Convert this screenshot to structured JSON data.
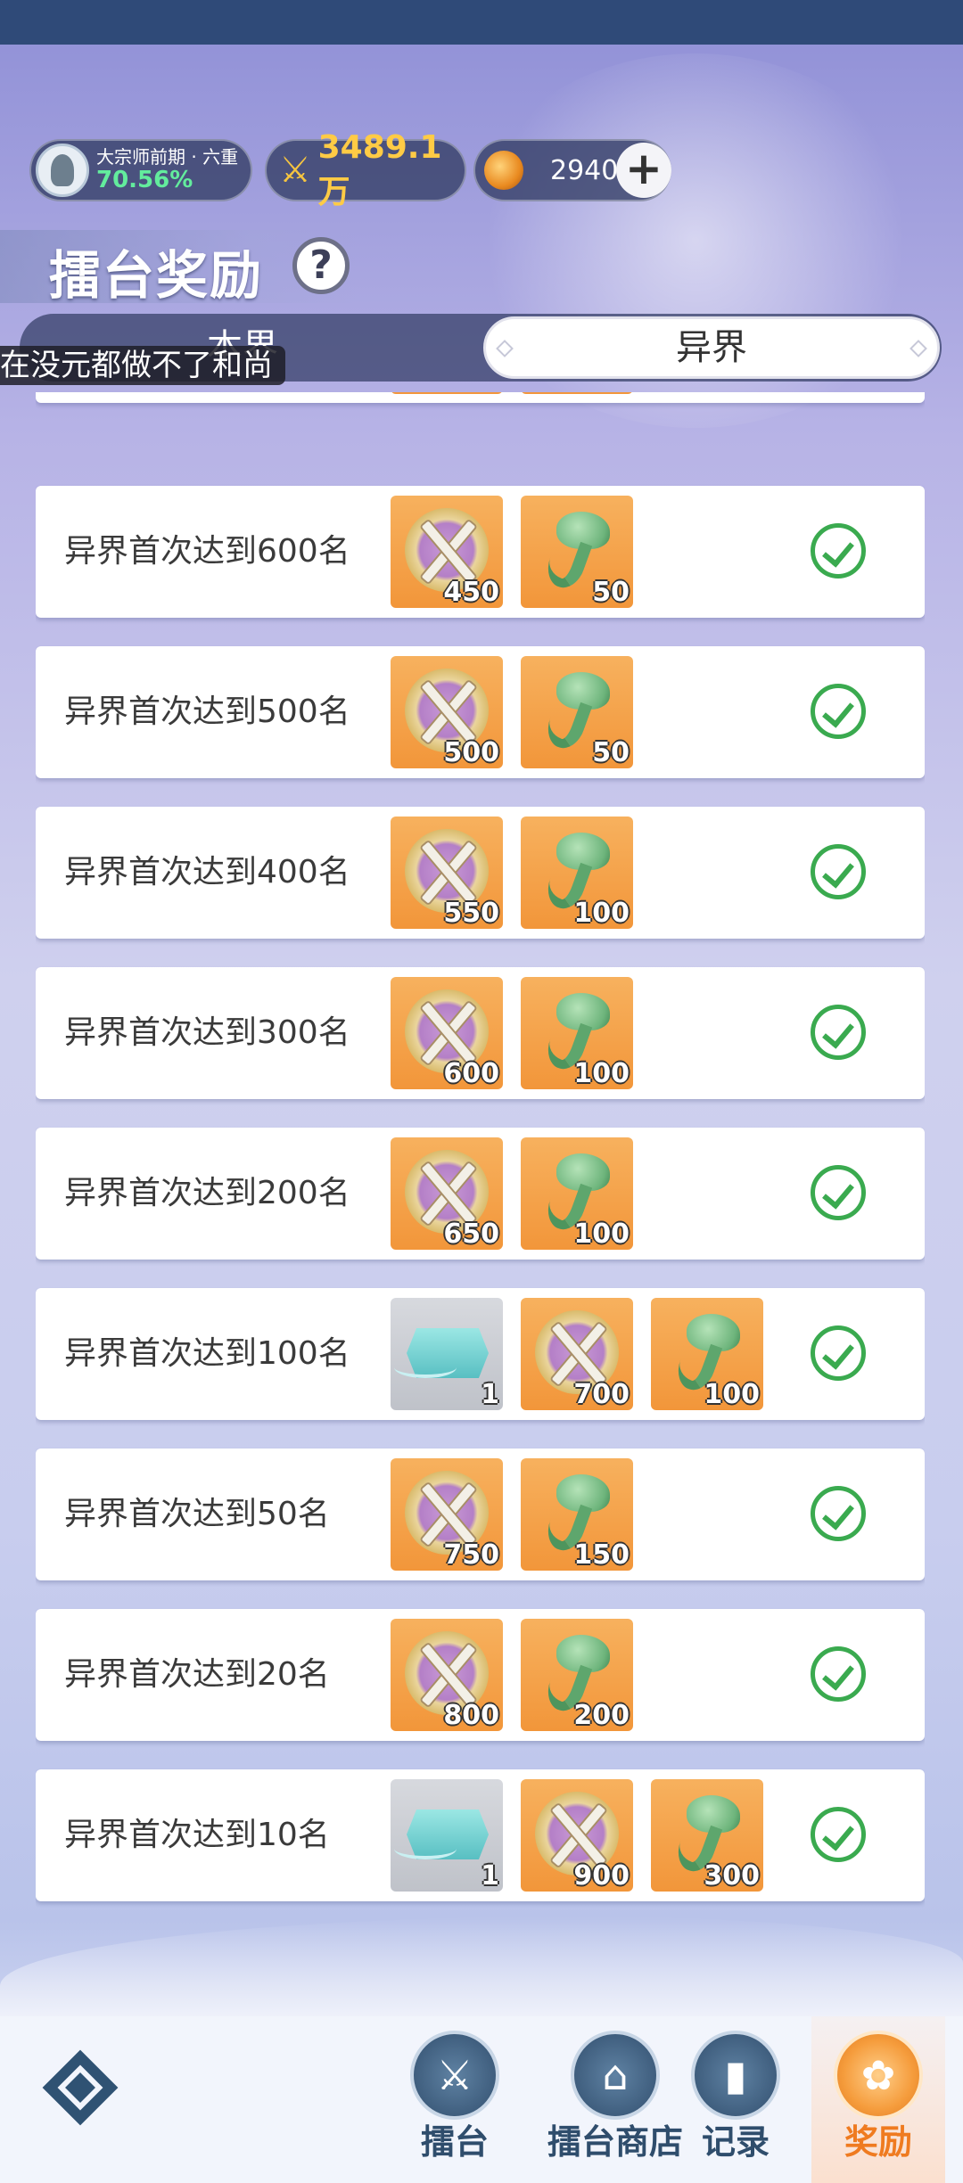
{
  "player": {
    "rank_name": "大宗师前期 · 六重",
    "rank_progress": "70.56%",
    "power": "3489.1万",
    "coins": "2940"
  },
  "page": {
    "title": "擂台奖励"
  },
  "tabs": [
    {
      "label": "本界",
      "active": false
    },
    {
      "label": "异界",
      "active": true
    }
  ],
  "overlay_text": "在没元都做不了和尚",
  "rewards": [
    {
      "label": "异界首次达到600名",
      "items": [
        {
          "type": "medal",
          "qty": "450"
        },
        {
          "type": "jade",
          "qty": "50"
        }
      ],
      "claimed": true
    },
    {
      "label": "异界首次达到500名",
      "items": [
        {
          "type": "medal",
          "qty": "500"
        },
        {
          "type": "jade",
          "qty": "50"
        }
      ],
      "claimed": true
    },
    {
      "label": "异界首次达到400名",
      "items": [
        {
          "type": "medal",
          "qty": "550"
        },
        {
          "type": "jade",
          "qty": "100"
        }
      ],
      "claimed": true
    },
    {
      "label": "异界首次达到300名",
      "items": [
        {
          "type": "medal",
          "qty": "600"
        },
        {
          "type": "jade",
          "qty": "100"
        }
      ],
      "claimed": true
    },
    {
      "label": "异界首次达到200名",
      "items": [
        {
          "type": "medal",
          "qty": "650"
        },
        {
          "type": "jade",
          "qty": "100"
        }
      ],
      "claimed": true
    },
    {
      "label": "异界首次达到100名",
      "items": [
        {
          "type": "token",
          "qty": "1"
        },
        {
          "type": "medal",
          "qty": "700"
        },
        {
          "type": "jade",
          "qty": "100"
        }
      ],
      "claimed": true
    },
    {
      "label": "异界首次达到50名",
      "items": [
        {
          "type": "medal",
          "qty": "750"
        },
        {
          "type": "jade",
          "qty": "150"
        }
      ],
      "claimed": true
    },
    {
      "label": "异界首次达到20名",
      "items": [
        {
          "type": "medal",
          "qty": "800"
        },
        {
          "type": "jade",
          "qty": "200"
        }
      ],
      "claimed": true
    },
    {
      "label": "异界首次达到10名",
      "items": [
        {
          "type": "token",
          "qty": "1"
        },
        {
          "type": "medal",
          "qty": "900"
        },
        {
          "type": "jade",
          "qty": "300"
        }
      ],
      "claimed": true
    }
  ],
  "nav": [
    {
      "label": "擂台",
      "icon": "arena-icon",
      "active": false
    },
    {
      "label": "擂台商店",
      "icon": "shop-icon",
      "active": false
    },
    {
      "label": "记录",
      "icon": "record-icon",
      "active": false
    },
    {
      "label": "奖励",
      "icon": "reward-icon",
      "active": true
    }
  ]
}
